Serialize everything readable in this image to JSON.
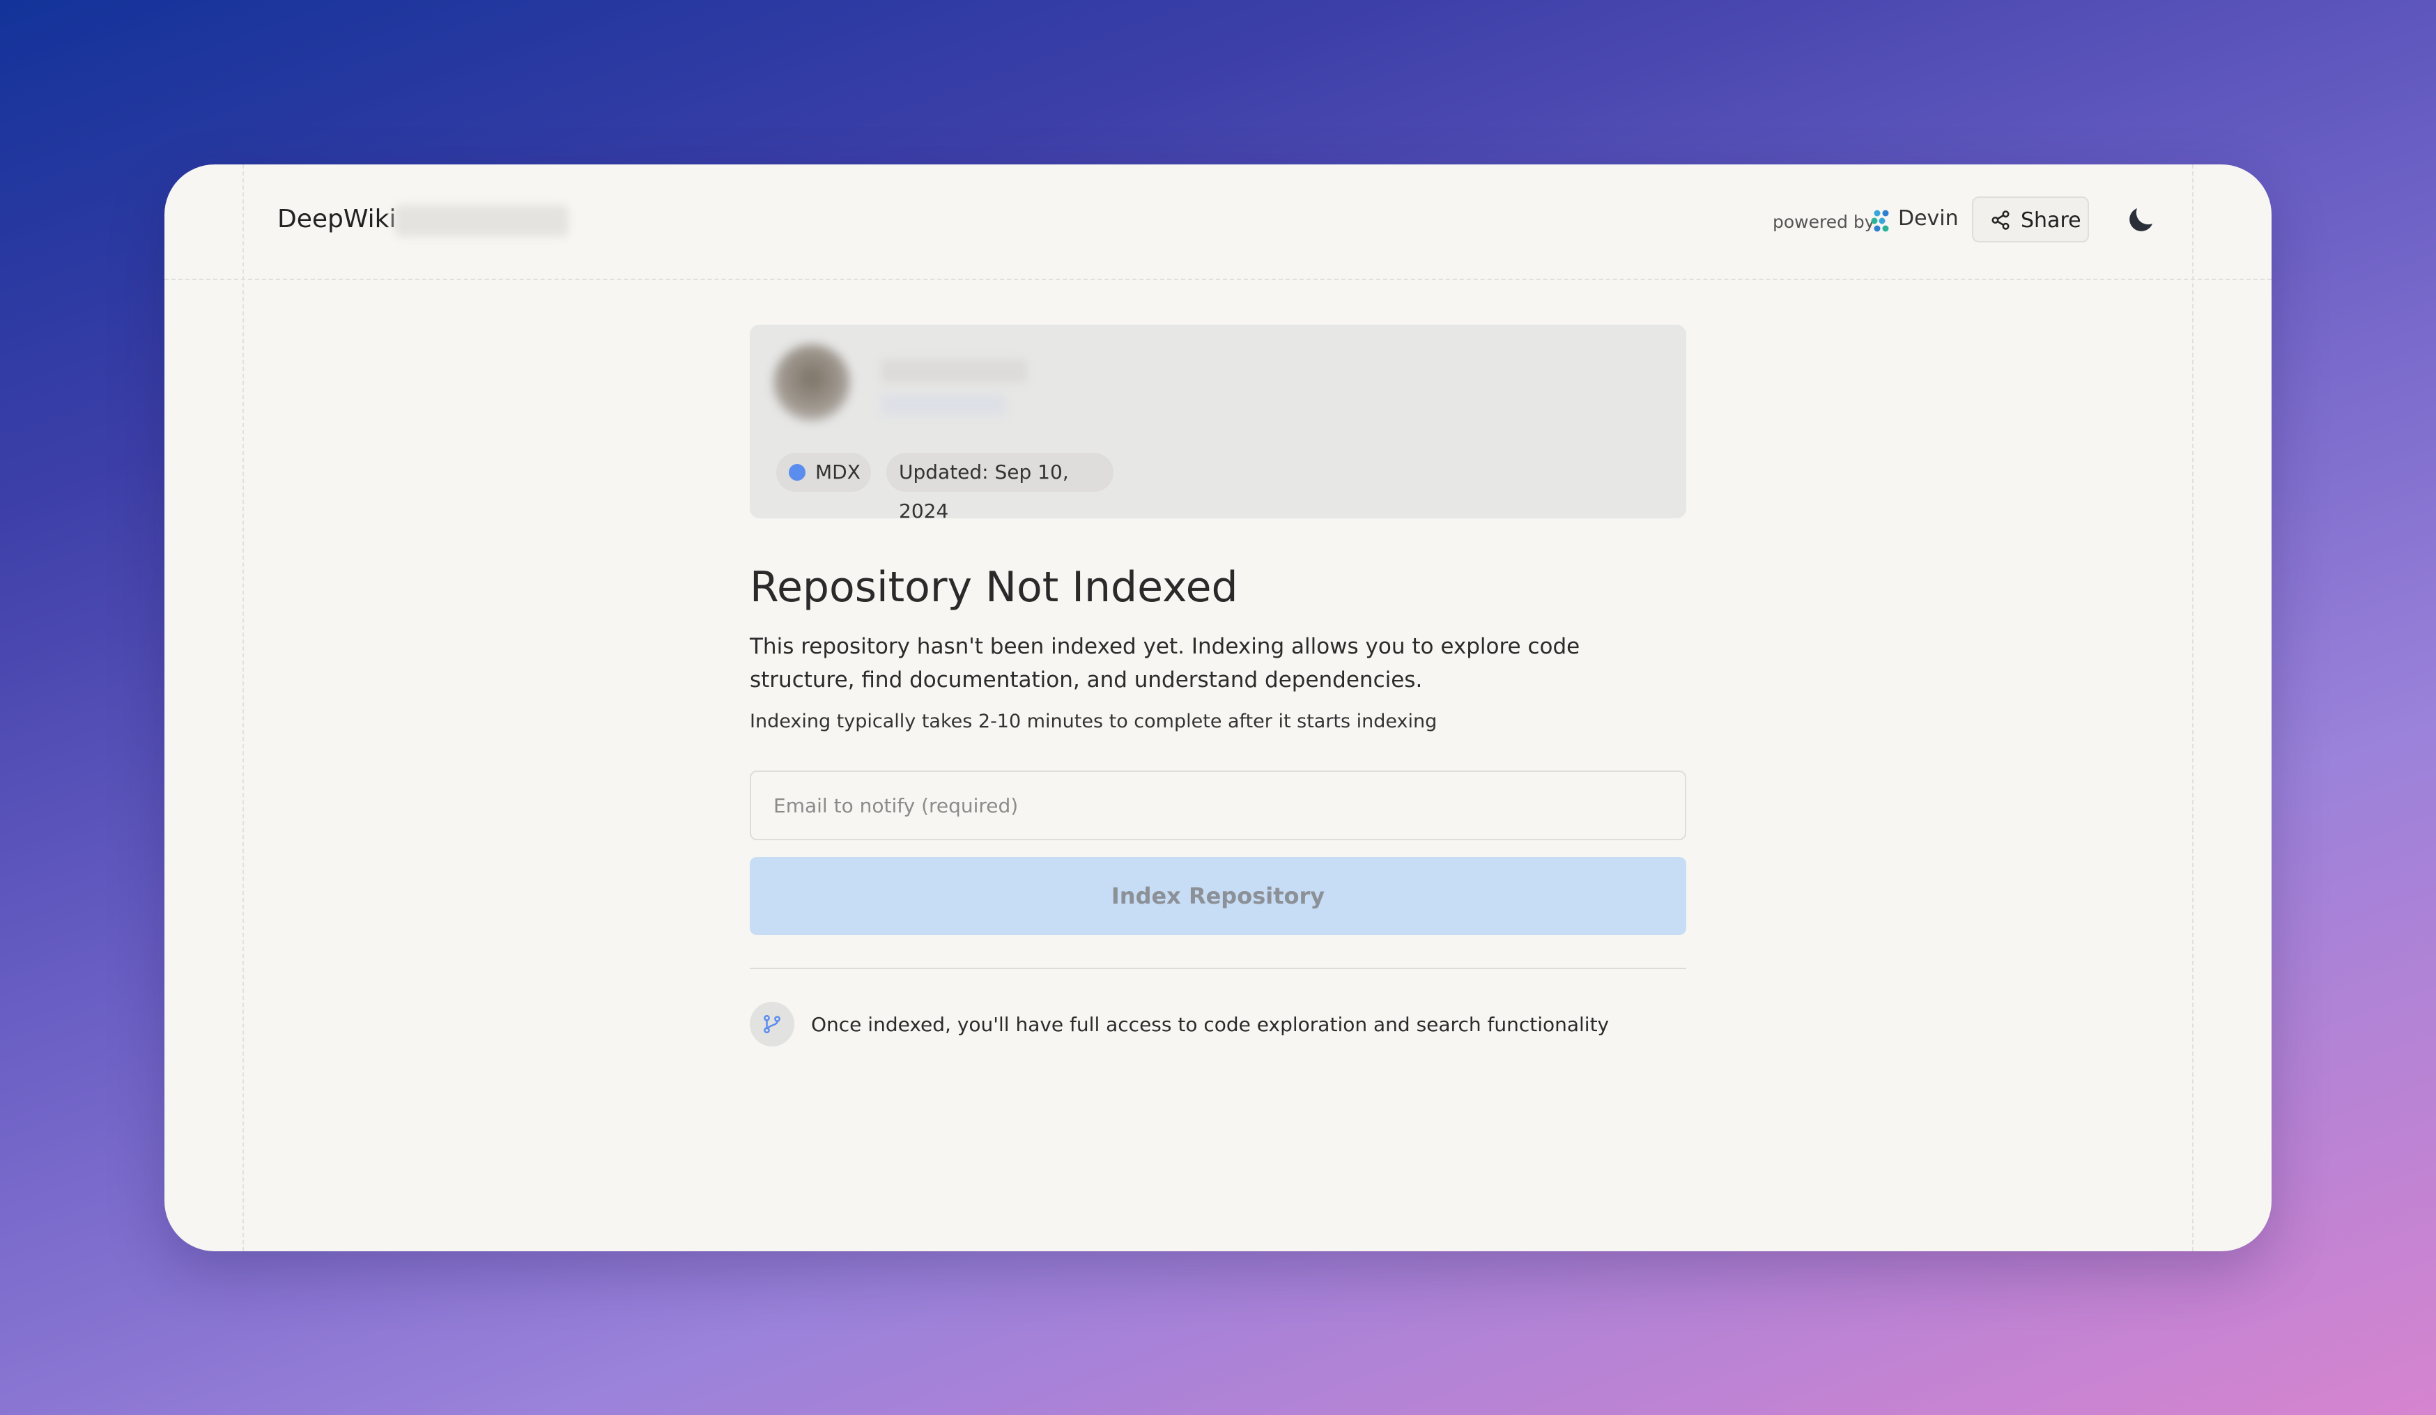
{
  "header": {
    "brand": "DeepWiki",
    "powered_by": "powered by",
    "devin_label": "Devin",
    "share_label": "Share"
  },
  "repo_card": {
    "language": "MDX",
    "language_color": "#5b8def",
    "updated": "Updated: Sep 10, 2024"
  },
  "main": {
    "title": "Repository Not Indexed",
    "description": "This repository hasn't been indexed yet. Indexing allows you to explore code structure, find documentation, and understand dependencies.",
    "timing_note": "Indexing typically takes 2-10 minutes to complete after it starts indexing",
    "email_placeholder": "Email to notify (required)",
    "email_value": "",
    "index_button_label": "Index Repository",
    "info_text": "Once indexed, you'll have full access to code exploration and search functionality"
  },
  "icons": {
    "devin": "devin-logo-icon",
    "share": "share-icon",
    "theme": "moon-icon",
    "info": "git-branch-icon"
  },
  "colors": {
    "accent": "#5b8def",
    "button_disabled_bg": "#c7dcf5",
    "page_bg": "#f7f6f3"
  }
}
